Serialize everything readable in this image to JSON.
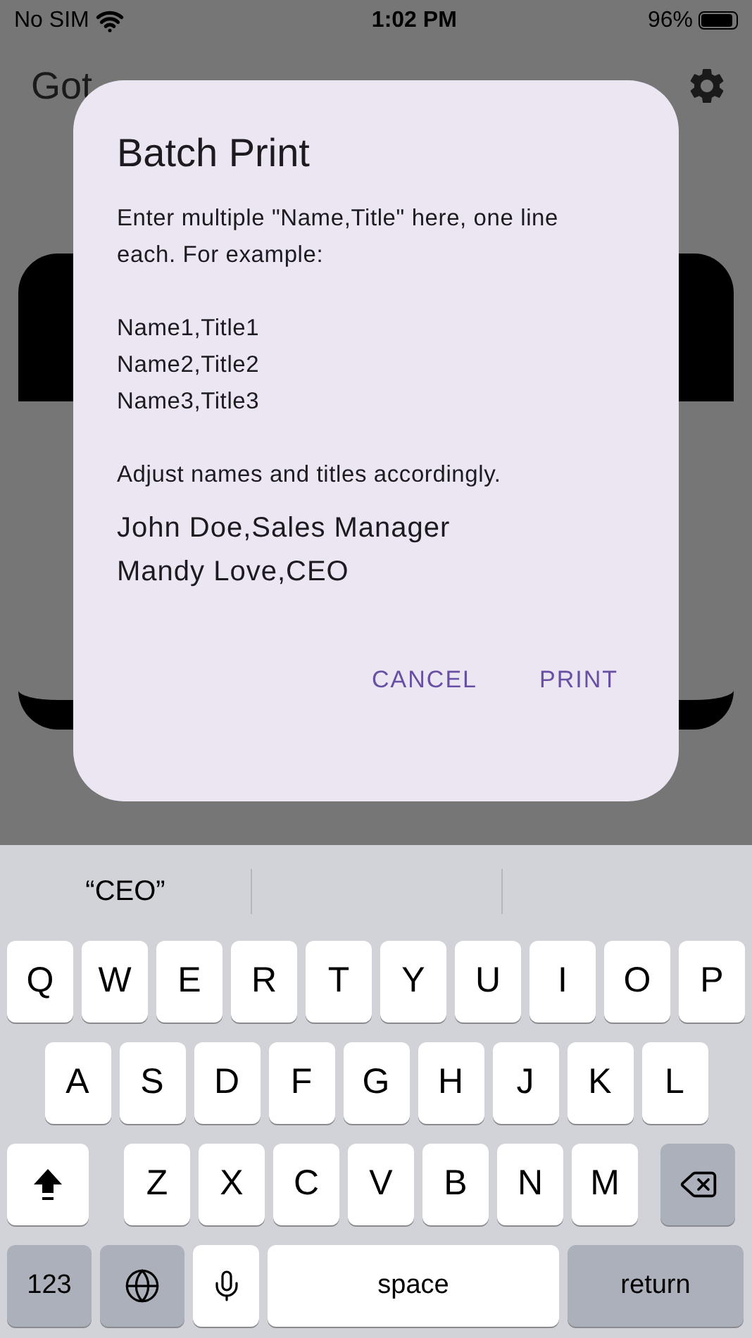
{
  "status_bar": {
    "carrier": "No SIM",
    "time": "1:02 PM",
    "battery": "96%"
  },
  "app_bar": {
    "title": "Got"
  },
  "dialog": {
    "title": "Batch Print",
    "intro": "Enter multiple \"Name,Title\" here, one line each. For example:",
    "examples": [
      "Name1,Title1",
      "Name2,Title2",
      "Name3,Title3"
    ],
    "note": "Adjust names and titles accordingly.",
    "field": {
      "value": "John Doe,Sales Manager\nMandy Love,CEO"
    },
    "buttons": [
      {
        "label": "CANCEL"
      },
      {
        "label": "PRINT"
      }
    ]
  },
  "keyboard": {
    "suggestions": [
      "“CEO”"
    ],
    "key_rows": [
      [
        {
          "kind": "letter",
          "label": "Q"
        },
        {
          "kind": "letter",
          "label": "W"
        },
        {
          "kind": "letter",
          "label": "E"
        },
        {
          "kind": "letter",
          "label": "R"
        },
        {
          "kind": "letter",
          "label": "T"
        },
        {
          "kind": "letter",
          "label": "Y"
        },
        {
          "kind": "letter",
          "label": "U"
        },
        {
          "kind": "letter",
          "label": "I"
        },
        {
          "kind": "letter",
          "label": "O"
        },
        {
          "kind": "letter",
          "label": "P"
        }
      ],
      [
        {
          "kind": "letter",
          "label": "A"
        },
        {
          "kind": "letter",
          "label": "S"
        },
        {
          "kind": "letter",
          "label": "D"
        },
        {
          "kind": "letter",
          "label": "F"
        },
        {
          "kind": "letter",
          "label": "G"
        },
        {
          "kind": "letter",
          "label": "H"
        },
        {
          "kind": "letter",
          "label": "J"
        },
        {
          "kind": "letter",
          "label": "K"
        },
        {
          "kind": "letter",
          "label": "L"
        }
      ],
      [
        {
          "kind": "shift"
        },
        {
          "kind": "letter",
          "label": "Z"
        },
        {
          "kind": "letter",
          "label": "X"
        },
        {
          "kind": "letter",
          "label": "C"
        },
        {
          "kind": "letter",
          "label": "V"
        },
        {
          "kind": "letter",
          "label": "B"
        },
        {
          "kind": "letter",
          "label": "N"
        },
        {
          "kind": "letter",
          "label": "M"
        },
        {
          "kind": "delete"
        }
      ],
      [
        {
          "kind": "numbers",
          "label": "123"
        },
        {
          "kind": "globe"
        },
        {
          "kind": "mic"
        },
        {
          "kind": "space",
          "label": "space"
        },
        {
          "kind": "return",
          "label": "return"
        }
      ]
    ]
  }
}
